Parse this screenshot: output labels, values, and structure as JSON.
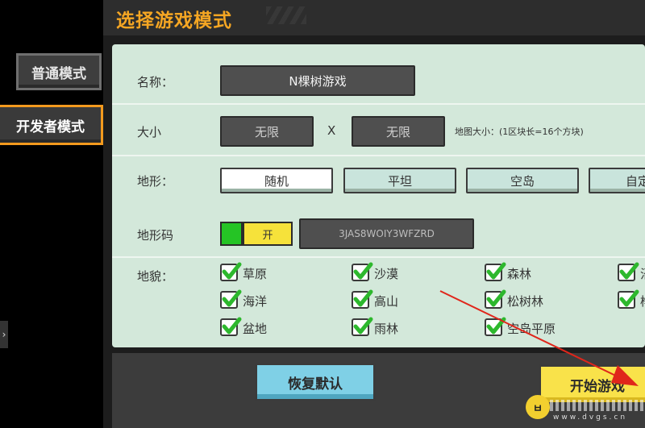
{
  "side_tabs": [
    "普通模式",
    "开发者模式"
  ],
  "left_arrow": "›",
  "dialog": {
    "title": "选择游戏模式",
    "name_label": "名称：",
    "name_value": "N棵树游戏",
    "size_label": "大小",
    "size_width": "无限",
    "size_x": "X",
    "size_height": "无限",
    "size_hint": "地图大小：(1区块长=16个方块)",
    "terrain_label": "地形：",
    "terrain_options": [
      "随机",
      "平坦",
      "空岛",
      "自定"
    ],
    "terrain_selected": "随机",
    "seed_label": "地形码",
    "seed_toggle": "开",
    "seed_value": "3JAS8WOIY3WFZRD",
    "biome_label": "地貌：",
    "biomes": [
      [
        "草原",
        "沙漠",
        "森林",
        "沼"
      ],
      [
        "海洋",
        "高山",
        "松树林",
        "桦"
      ],
      [
        "盆地",
        "雨林",
        "空岛平原"
      ]
    ],
    "reset_button": "恢复默认",
    "start_button": "开始游戏"
  },
  "watermark": {
    "logo": "ㅂ",
    "url": "www.dvgs.cn"
  },
  "colors": {
    "accent": "#f5a623",
    "panel": "#d3e8da",
    "start": "#f9e24a",
    "reset": "#7fd0e6",
    "check": "#2db82d"
  }
}
